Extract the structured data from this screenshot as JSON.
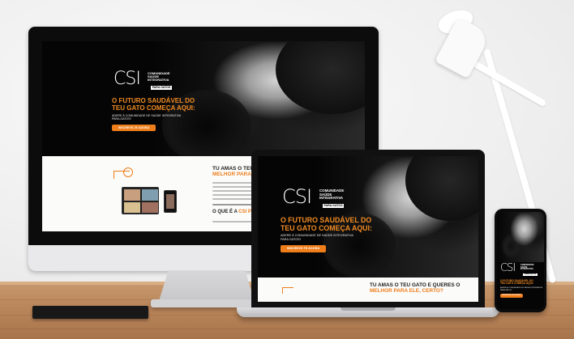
{
  "site": {
    "logo_mark": "CSI",
    "logo_line1": "COMUNIDADE",
    "logo_line2": "SAÚDE",
    "logo_line3": "INTEGRATIVA",
    "logo_tag": "PARA GATOS",
    "headline_line1": "O FUTURO SAUDÁVEL DO",
    "headline_line2": "TEU GATO COMEÇA AQUI:",
    "subline_line1": "ADERE À COMUNIDADE DE SAÚDE INTEGRATIVA",
    "subline_line2": "PARA GATOS!",
    "cta_label": "INSCREVE-TE AGORA",
    "section_title_line1": "TU AMAS O TEU GATO E QUERES O",
    "section_title_hl": "MELHOR PARA ELE, CERTO?",
    "section2_prefix": "O QUE É A",
    "section2_hl": "CSI PARA"
  },
  "colors": {
    "accent": "#ee7d1a",
    "headline": "#f28b22",
    "hero_bg": "#050505",
    "lower_bg": "#fbfbfa"
  }
}
